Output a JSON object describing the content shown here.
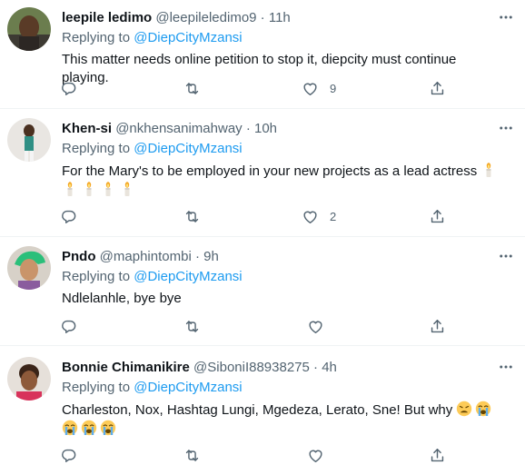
{
  "tweets": [
    {
      "name": "leepile ledimo",
      "handle": "@leepileledimo9",
      "time": "11h",
      "reply_prefix": "Replying to ",
      "reply_to": "@DiepCityMzansi",
      "text": "This matter needs online petition to stop it, diepcity must continue playing.",
      "likes": "9"
    },
    {
      "name": "Khen-si",
      "handle": "@nkhensanimahway",
      "time": "10h",
      "reply_prefix": "Replying to ",
      "reply_to": "@DiepCityMzansi",
      "text": "For the Mary's to be employed in your new projects as a lead actress",
      "likes": "2"
    },
    {
      "name": "Pndo",
      "handle": "@maphintombi",
      "time": "9h",
      "reply_prefix": "Replying to ",
      "reply_to": "@DiepCityMzansi",
      "text": "Ndlelanhle, bye bye",
      "likes": ""
    },
    {
      "name": "Bonnie Chimanikire",
      "handle": "@SiboniI88938275",
      "time": "4h",
      "reply_prefix": "Replying to ",
      "reply_to": "@DiepCityMzansi",
      "text": "Charleston, Nox, Hashtag Lungi, Mgedeza, Lerato, Sne! But why",
      "likes": ""
    }
  ],
  "separator": "·",
  "icons": {
    "reply": "reply-icon",
    "retweet": "retweet-icon",
    "like": "heart-icon",
    "share": "share-icon",
    "more": "more-icon",
    "candle": "candle-emoji",
    "weary": "weary-face-emoji",
    "crying": "loudly-crying-face-emoji"
  },
  "colors": {
    "link": "#1d9bf0",
    "secondary": "#536471",
    "primary": "#0f1419",
    "divider": "#eff3f4"
  }
}
